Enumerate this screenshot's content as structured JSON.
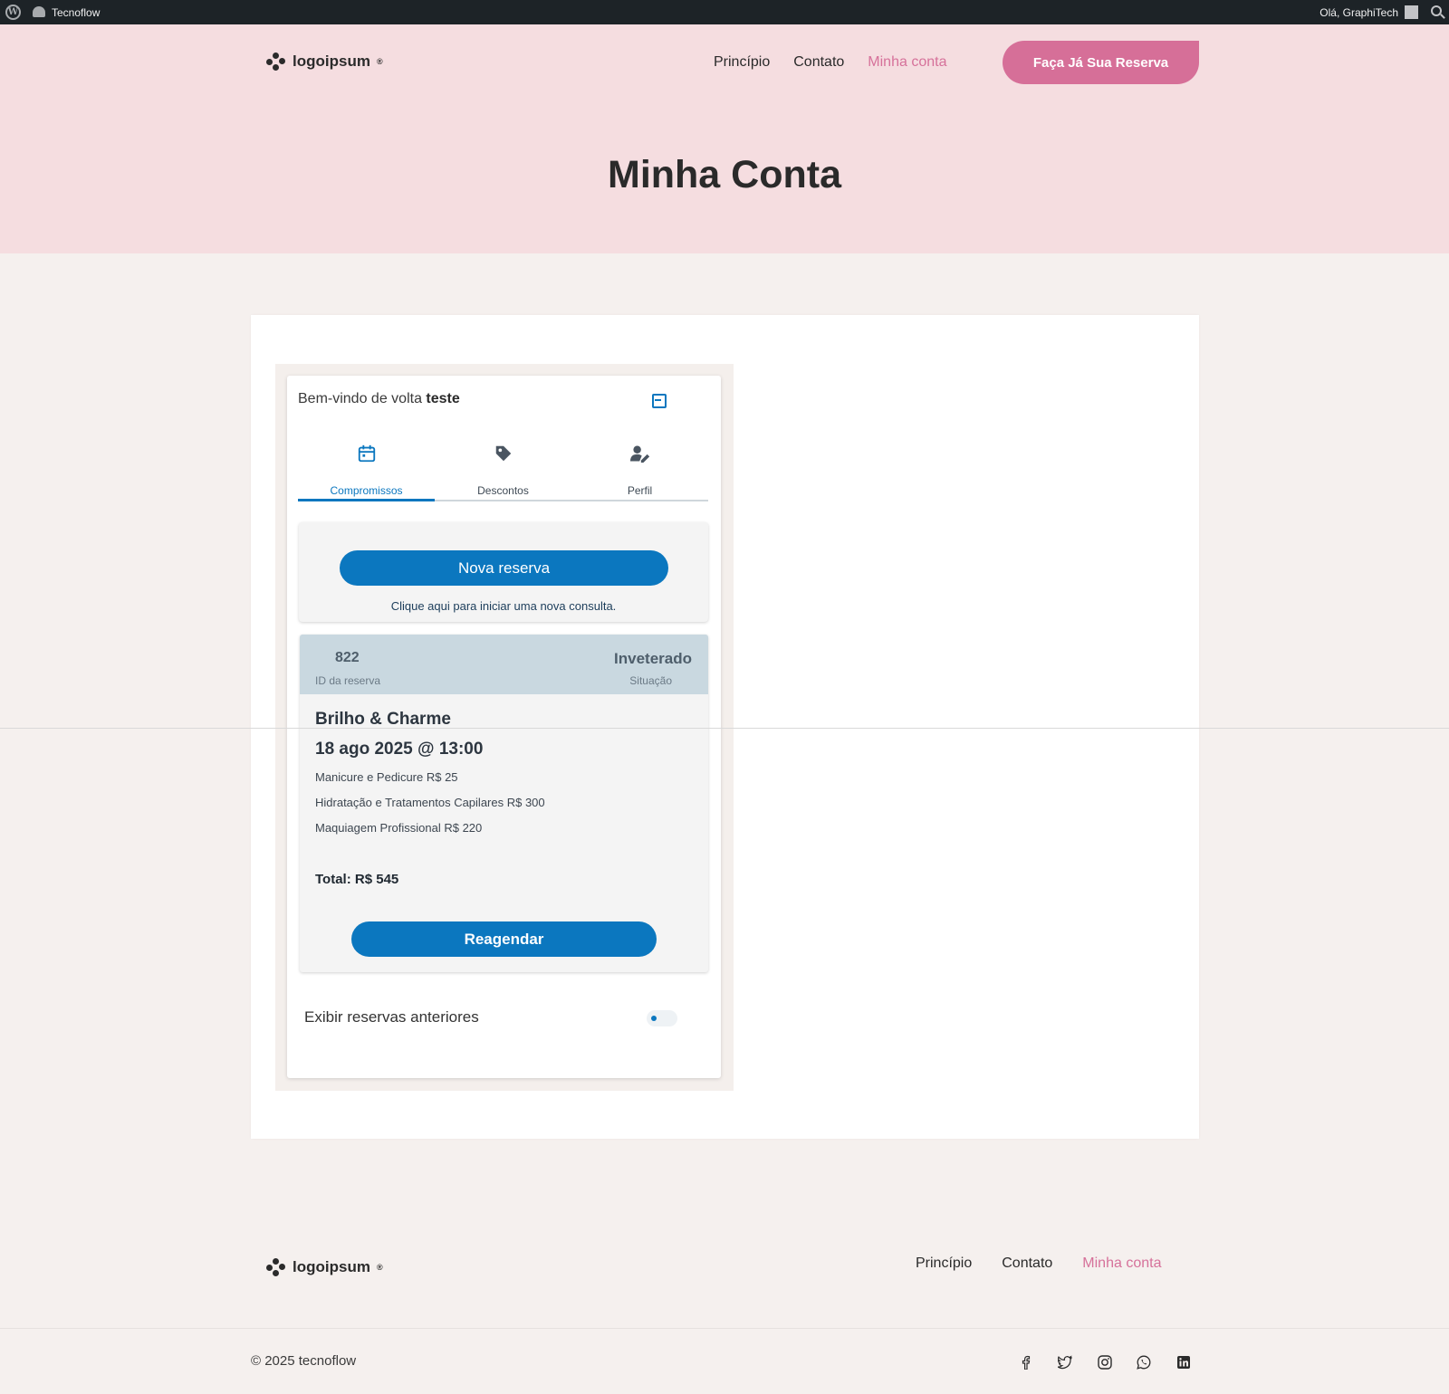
{
  "adminbar": {
    "site_name": "Tecnoflow",
    "greeting": "Olá, GraphiTech"
  },
  "header": {
    "logo_text": "logoipsum",
    "logo_mark": "®",
    "nav": [
      {
        "label": "Princípio",
        "active": false
      },
      {
        "label": "Contato",
        "active": false
      },
      {
        "label": "Minha conta",
        "active": true
      }
    ],
    "cta_label": "Faça Já Sua Reserva",
    "page_title": "Minha Conta"
  },
  "account": {
    "welcome_prefix": "Bem-vindo de volta",
    "username": "teste",
    "tabs": [
      {
        "label": "Compromissos",
        "icon": "calendar-icon",
        "active": true
      },
      {
        "label": "Descontos",
        "icon": "tag-icon",
        "active": false
      },
      {
        "label": "Perfil",
        "icon": "user-edit-icon",
        "active": false
      }
    ],
    "new_booking": {
      "button_label": "Nova reserva",
      "hint": "Clique aqui para iniciar uma nova consulta."
    },
    "reservation": {
      "id": "822",
      "id_label": "ID da reserva",
      "status": "Inveterado",
      "status_label": "Situação",
      "salon": "Brilho & Charme",
      "datetime": "18 ago 2025 @ 13:00",
      "services": [
        "Manicure e Pedicure R$ 25",
        "Hidratação e Tratamentos Capilares R$ 300",
        "Maquiagem Profissional R$ 220"
      ],
      "total_label": "Total:",
      "total_value": "R$ 545",
      "reschedule_label": "Reagendar"
    },
    "show_previous_label": "Exibir reservas anteriores",
    "show_previous_on": false
  },
  "footer": {
    "logo_text": "logoipsum",
    "logo_mark": "®",
    "nav": [
      {
        "label": "Princípio",
        "active": false
      },
      {
        "label": "Contato",
        "active": false
      },
      {
        "label": "Minha conta",
        "active": true
      }
    ],
    "copyright": "© 2025 tecnoflow",
    "social": [
      "facebook-icon",
      "twitter-icon",
      "instagram-icon",
      "whatsapp-icon",
      "linkedin-icon"
    ]
  },
  "colors": {
    "accent_pink": "#d66f98",
    "primary_blue": "#0b77bf",
    "hero_bg": "#f5dde0",
    "page_bg": "#f5f0ee"
  }
}
